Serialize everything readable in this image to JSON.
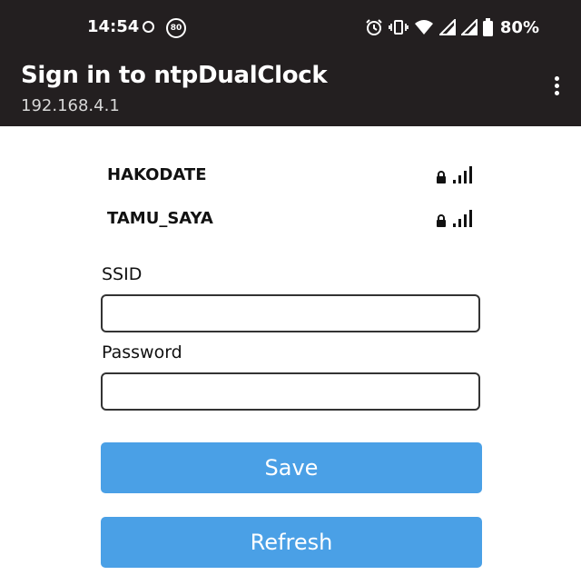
{
  "status_bar": {
    "time": "14:54",
    "notification_badge": "80",
    "battery_percent": "80%",
    "icons": [
      "alarm-icon",
      "vibrate-icon",
      "wifi-icon",
      "signal-icon",
      "signal-icon",
      "battery-icon"
    ]
  },
  "app_bar": {
    "title": "Sign in to ntpDualClock",
    "subtitle": "192.168.4.1",
    "menu_icon": "more-vert-icon"
  },
  "networks": [
    {
      "ssid": "HAKODATE",
      "secured": true,
      "signal_bars": 4
    },
    {
      "ssid": "TAMU_SAYA",
      "secured": true,
      "signal_bars": 4
    }
  ],
  "form": {
    "ssid_label": "SSID",
    "ssid_value": "",
    "password_label": "Password",
    "password_value": "",
    "save_label": "Save",
    "refresh_label": "Refresh"
  },
  "colors": {
    "header_bg": "#231f20",
    "button_bg": "#4aa0e6",
    "button_text": "#ffffff"
  }
}
